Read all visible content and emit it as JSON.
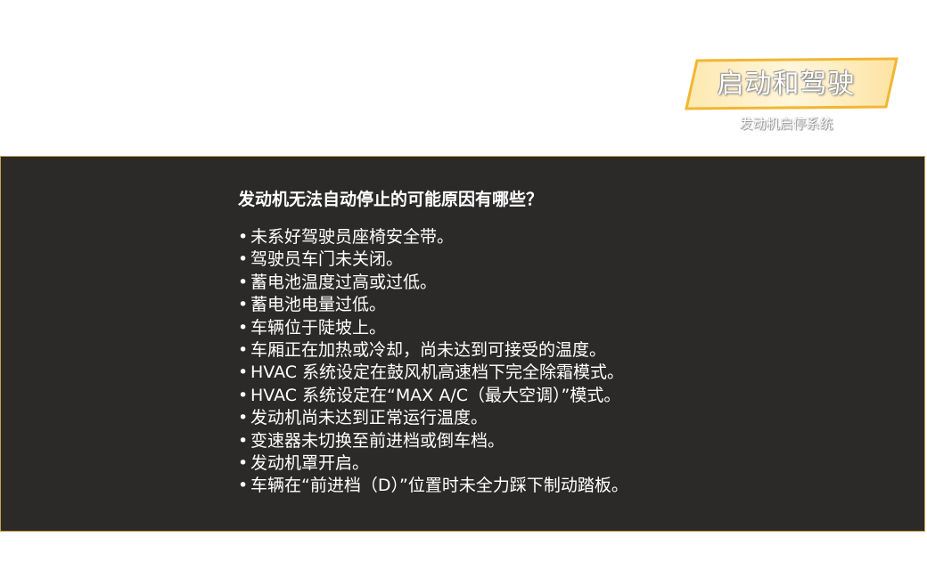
{
  "badge": {
    "title": "启动和驾驶",
    "subtitle": "发动机启停系统",
    "accent_color": "#f2b632"
  },
  "content": {
    "heading": "发动机无法自动停止的可能原因有哪些？",
    "bullet_symbol": "•",
    "items": [
      "未系好驾驶员座椅安全带。",
      "驾驶员车门未关闭。",
      "蓄电池温度过高或过低。",
      "蓄电池电量过低。",
      "车辆位于陡坡上。",
      "车厢正在加热或冷却，尚未达到可接受的温度。",
      "HVAC 系统设定在鼓风机高速档下完全除霜模式。",
      "HVAC 系统设定在“MAX A/C（最大空调）”模式。",
      "发动机尚未达到正常运行温度。",
      "变速器未切换至前进档或倒车档。",
      "发动机罩开启。",
      "车辆在“前进档（D）”位置时未全力踩下制动踏板。"
    ]
  },
  "colors": {
    "panel_background": "#2b2a29",
    "panel_border": "#c9a24a",
    "text": "#ffffff"
  }
}
